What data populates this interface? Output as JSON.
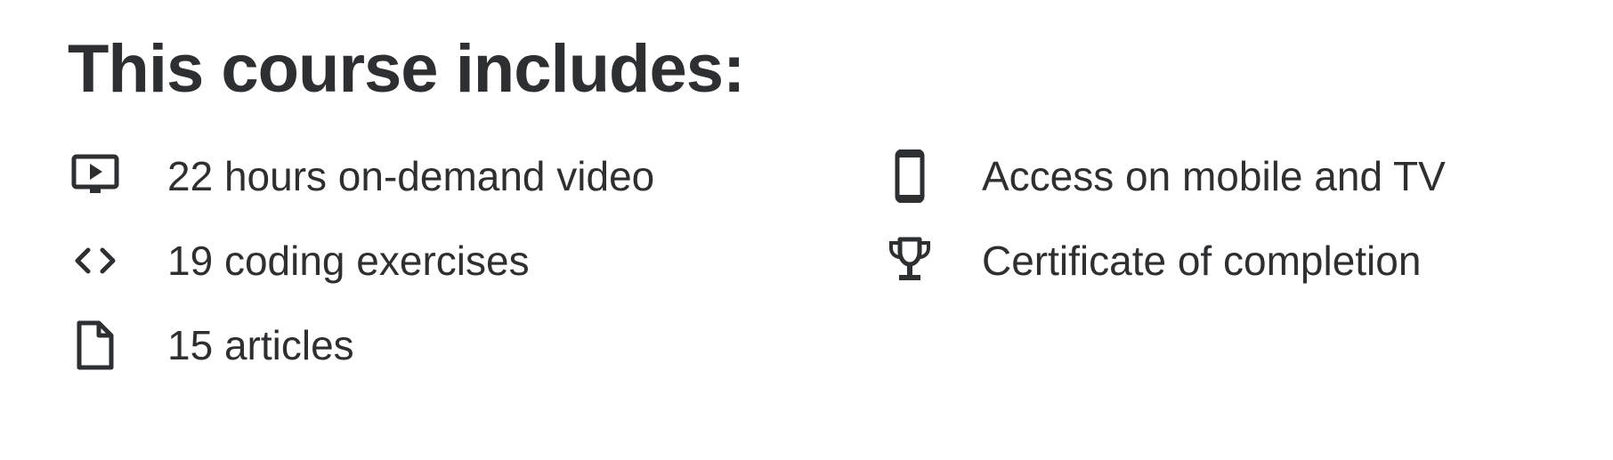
{
  "section": {
    "title": "This course includes:"
  },
  "features": [
    {
      "icon": "video-icon",
      "label": "22 hours on-demand video"
    },
    {
      "icon": "mobile-icon",
      "label": "Access on mobile and TV"
    },
    {
      "icon": "code-icon",
      "label": "19 coding exercises"
    },
    {
      "icon": "trophy-icon",
      "label": "Certificate of completion"
    },
    {
      "icon": "article-icon",
      "label": "15 articles"
    }
  ],
  "colors": {
    "text": "#2d2f31",
    "background": "#ffffff"
  }
}
